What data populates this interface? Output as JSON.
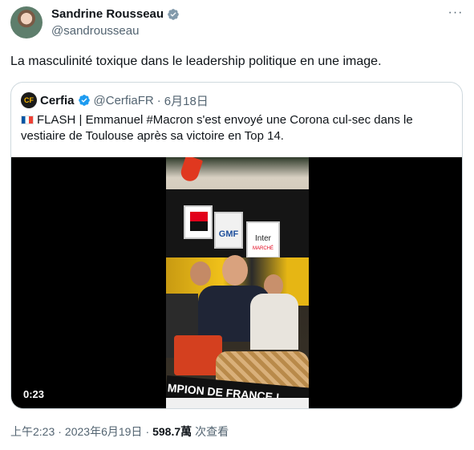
{
  "author": {
    "name": "Sandrine Rousseau",
    "handle": "@sandrousseau"
  },
  "more_label": "···",
  "tweet": {
    "text": "La masculinité toxique dans le leadership politique en une image."
  },
  "quoted": {
    "logo_text": "CF",
    "name": "Cerfia",
    "handle": "@CerfiaFR",
    "separator": "·",
    "date": "6月18日",
    "text": "FLASH | Emmanuel #Macron s'est envoyé une Corona cul-sec dans le vestiaire de Toulouse après sa victoire en Top 14.",
    "video": {
      "duration": "0:23",
      "sign_gmf": "GMF",
      "sign_brand": "Inter",
      "sign_brand_sub": "MARCHÉ",
      "banner": "MPION DE FRANCE !"
    }
  },
  "footer": {
    "time": "上午2:23",
    "sep1": "·",
    "date": "2023年6月19日",
    "sep2": "·",
    "views": "598.7萬",
    "views_label": "次查看"
  },
  "colors": {
    "verified": "#1d9bf0",
    "text": "#0f1419",
    "muted": "#536471",
    "border": "#cfd9de"
  }
}
